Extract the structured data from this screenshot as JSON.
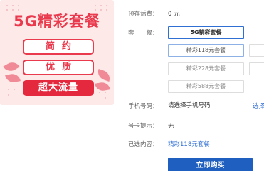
{
  "promo": {
    "title": "5G精彩套餐",
    "tag1": "简约",
    "tag2": "优质",
    "tag3": "超大流量"
  },
  "form": {
    "prestored_label": "预存话费：",
    "prestored_value": "0 元",
    "package_label": "套　　餐：",
    "packages": [
      {
        "label": "5G精彩套餐",
        "state": "selected"
      },
      {
        "label": "精彩118元套餐",
        "state": "hover"
      },
      {
        "label": "精彩228元套餐",
        "state": "normal"
      },
      {
        "label": "精彩588元套餐",
        "state": "normal"
      }
    ],
    "phone_label": "手机号码：",
    "phone_placeholder": "请选择手机号码",
    "phone_link": "选择",
    "card_tip_label": "号卡提示：",
    "card_tip_value": "无",
    "selected_label": "已选内容：",
    "selected_value": "精彩118元套餐",
    "buy_button": "立即购买"
  },
  "colors": {
    "promo_red": "#ea3a4e",
    "link_blue": "#2f6ed3",
    "button_blue": "#1e5fbf"
  }
}
